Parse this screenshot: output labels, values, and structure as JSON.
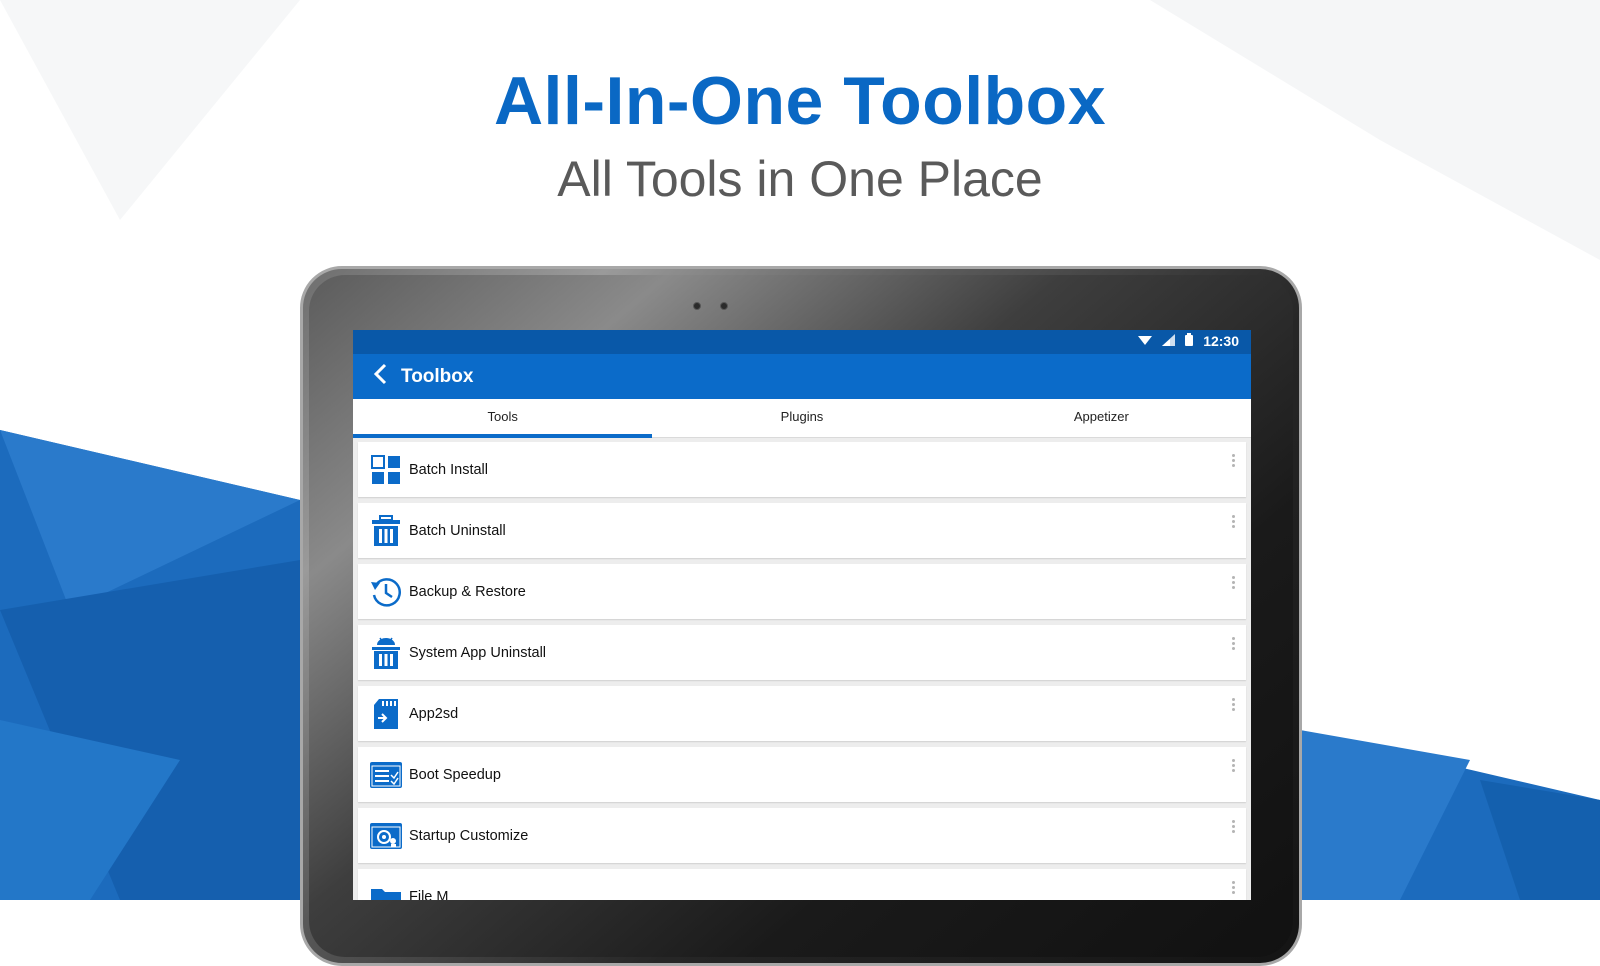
{
  "hero": {
    "title": "All-In-One Toolbox",
    "subtitle": "All Tools in One Place"
  },
  "status_bar": {
    "time": "12:30",
    "icons": [
      "wifi-icon",
      "signal-icon",
      "battery-icon"
    ]
  },
  "app_bar": {
    "back_icon": "chevron-left-icon",
    "title": "Toolbox"
  },
  "tabs": [
    {
      "label": "Tools",
      "active": true
    },
    {
      "label": "Plugins",
      "active": false
    },
    {
      "label": "Appetizer",
      "active": false
    }
  ],
  "tools": [
    {
      "label": "Batch Install",
      "icon": "grid-icon"
    },
    {
      "label": "Batch Uninstall",
      "icon": "trash-icon"
    },
    {
      "label": "Backup & Restore",
      "icon": "history-clock-icon"
    },
    {
      "label": "System App Uninstall",
      "icon": "android-trash-icon"
    },
    {
      "label": "App2sd",
      "icon": "sd-card-icon"
    },
    {
      "label": "Boot Speedup",
      "icon": "boot-list-icon"
    },
    {
      "label": "Startup Customize",
      "icon": "startup-gear-icon"
    },
    {
      "label": "File M",
      "icon": "folder-icon"
    }
  ],
  "colors": {
    "accent": "#0b6bc9",
    "status_bar": "#0958a8",
    "hero_title": "#0a68c4",
    "background_blue": "#1f6fbf"
  }
}
